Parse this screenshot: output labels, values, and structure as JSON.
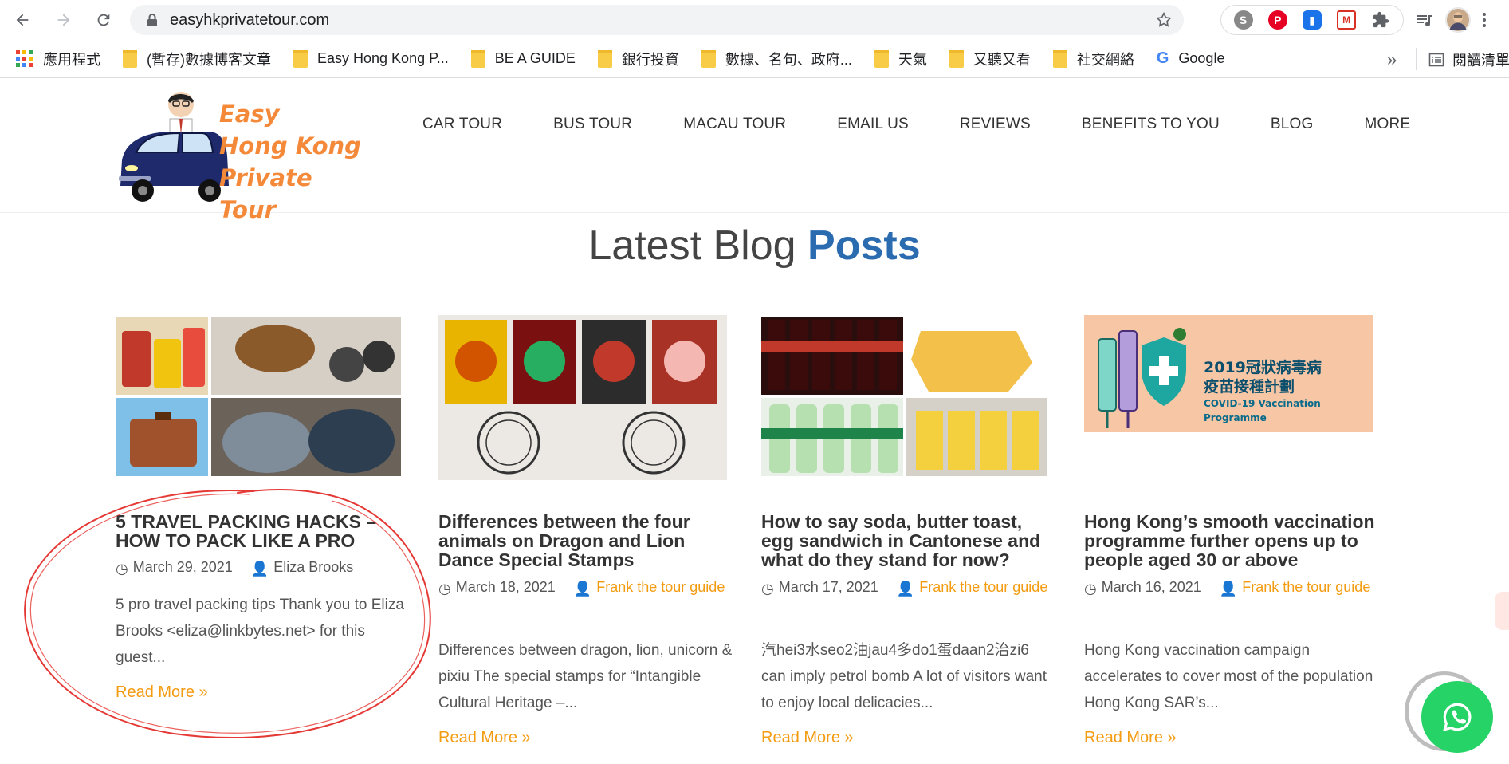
{
  "browser": {
    "url": "easyhkprivatetour.com",
    "bookmarks": [
      {
        "label": "應用程式",
        "icon": "apps-grid-icon"
      },
      {
        "label": "(暫存)數據博客文章",
        "icon": "folder-icon"
      },
      {
        "label": "Easy Hong Kong P...",
        "icon": "folder-icon"
      },
      {
        "label": "BE A GUIDE",
        "icon": "folder-icon"
      },
      {
        "label": "銀行投資",
        "icon": "folder-icon"
      },
      {
        "label": "數據、名句、政府...",
        "icon": "folder-icon"
      },
      {
        "label": "天氣",
        "icon": "folder-icon"
      },
      {
        "label": "又聽又看",
        "icon": "folder-icon"
      },
      {
        "label": "社交網絡",
        "icon": "folder-icon"
      },
      {
        "label": "Google",
        "icon": "google-icon"
      }
    ],
    "more": "»",
    "reading_list": "閱讀清單"
  },
  "site": {
    "logo_lines": [
      "Easy",
      "Hong Kong",
      "Private Tour"
    ],
    "nav": [
      "CAR TOUR",
      "BUS TOUR",
      "MACAU TOUR",
      "EMAIL US",
      "REVIEWS",
      "BENEFITS TO YOU",
      "BLOG",
      "MORE"
    ]
  },
  "section": {
    "title_plain": "Latest Blog",
    "title_accent": "Posts"
  },
  "posts": [
    {
      "title": "5 TRAVEL PACKING HACKS – HOW TO PACK LIKE A PRO",
      "date": "March 29, 2021",
      "author": "Eliza Brooks",
      "excerpt": "5 pro travel packing tips Thank you to Eliza Brooks <eliza@linkbytes.net> for this guest...",
      "read_more": "Read More »"
    },
    {
      "title": "Differences between the four animals on Dragon and Lion Dance Special Stamps",
      "date": "March 18, 2021",
      "author": "Frank the tour guide",
      "excerpt": "Differences between dragon, lion, unicorn & pixiu The special stamps for “Intangible Cultural Heritage –...",
      "read_more": "Read More »"
    },
    {
      "title": "How to say soda, butter toast, egg sandwich in Cantonese and what do they stand for now?",
      "date": "March 17, 2021",
      "author": "Frank the tour guide",
      "excerpt": "汽hei3水seo2油jau4多do1蛋daan2治zi6 can imply petrol bomb A lot of visitors want to enjoy local delicacies...",
      "read_more": "Read More »"
    },
    {
      "title": "Hong Kong’s smooth vaccination programme further opens up to people aged 30 or above",
      "date": "March 16, 2021",
      "author": "Frank the tour guide",
      "excerpt": "Hong Kong vaccination campaign accelerates to cover most of the population Hong Kong SAR’s...",
      "read_more": "Read More »"
    }
  ],
  "vaccine_banner": {
    "line1": "2019冠狀病毒病",
    "line2": "疫苗接種計劃",
    "line3": "COVID-19 Vaccination Programme"
  },
  "colors": {
    "accent_blue": "#2b6cb0",
    "accent_orange": "#f39c12",
    "logo_orange": "#f4893a",
    "whatsapp": "#25d366",
    "annotation": "#e53935"
  }
}
